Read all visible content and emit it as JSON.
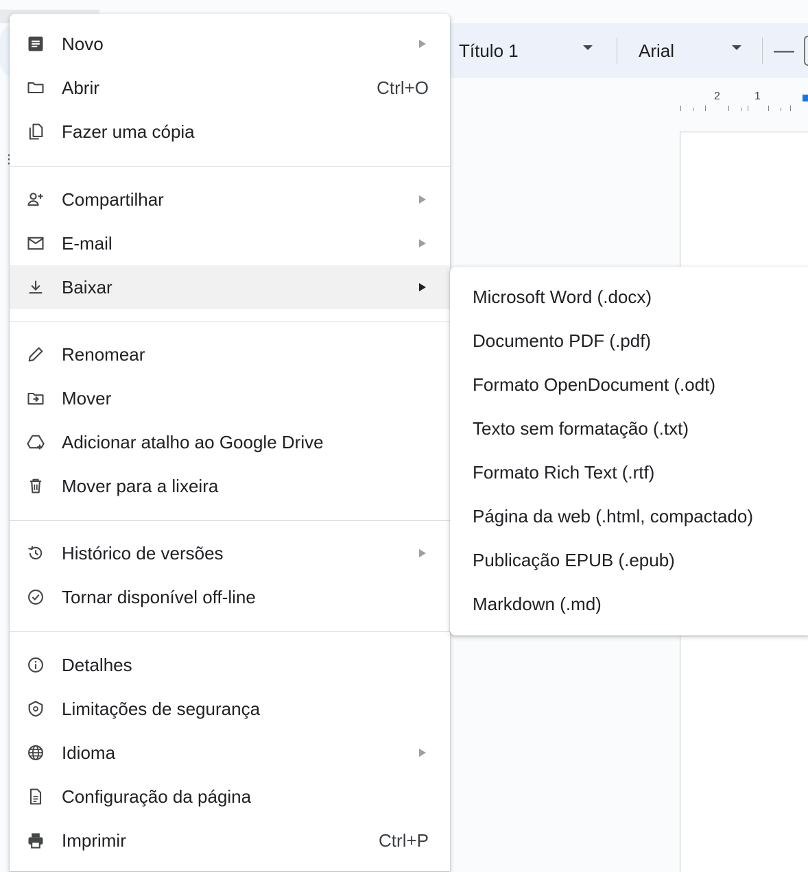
{
  "toolbar": {
    "style_value": "Título 1",
    "font_value": "Arial",
    "font_size_decrease": "—"
  },
  "ruler": {
    "labels": [
      "2",
      "1"
    ]
  },
  "file_menu": {
    "items": [
      {
        "label": "Novo",
        "icon": "document-icon",
        "submenu": true
      },
      {
        "label": "Abrir",
        "icon": "folder-icon",
        "shortcut": "Ctrl+O"
      },
      {
        "label": "Fazer uma cópia",
        "icon": "copy-icon"
      },
      {
        "label": "Compartilhar",
        "icon": "person-add-icon",
        "submenu": true
      },
      {
        "label": "E-mail",
        "icon": "mail-icon",
        "submenu": true
      },
      {
        "label": "Baixar",
        "icon": "download-icon",
        "submenu": true,
        "highlighted": true
      },
      {
        "label": "Renomear",
        "icon": "pencil-icon"
      },
      {
        "label": "Mover",
        "icon": "folder-move-icon"
      },
      {
        "label": "Adicionar atalho ao Google Drive",
        "icon": "drive-shortcut-icon"
      },
      {
        "label": "Mover para a lixeira",
        "icon": "trash-icon"
      },
      {
        "label": "Histórico de versões",
        "icon": "history-icon",
        "submenu": true
      },
      {
        "label": "Tornar disponível off-line",
        "icon": "offline-icon"
      },
      {
        "label": "Detalhes",
        "icon": "info-icon"
      },
      {
        "label": "Limitações de segurança",
        "icon": "security-icon"
      },
      {
        "label": "Idioma",
        "icon": "globe-icon",
        "submenu": true
      },
      {
        "label": "Configuração da página",
        "icon": "page-setup-icon"
      },
      {
        "label": "Imprimir",
        "icon": "printer-icon",
        "shortcut": "Ctrl+P"
      }
    ]
  },
  "download_submenu": {
    "items": [
      {
        "label": "Microsoft Word (.docx)"
      },
      {
        "label": "Documento PDF (.pdf)"
      },
      {
        "label": "Formato OpenDocument (.odt)"
      },
      {
        "label": "Texto sem formatação (.txt)"
      },
      {
        "label": "Formato Rich Text (.rtf)"
      },
      {
        "label": "Página da web (.html, compactado)"
      },
      {
        "label": "Publicação EPUB (.epub)"
      },
      {
        "label": "Markdown (.md)"
      }
    ]
  }
}
